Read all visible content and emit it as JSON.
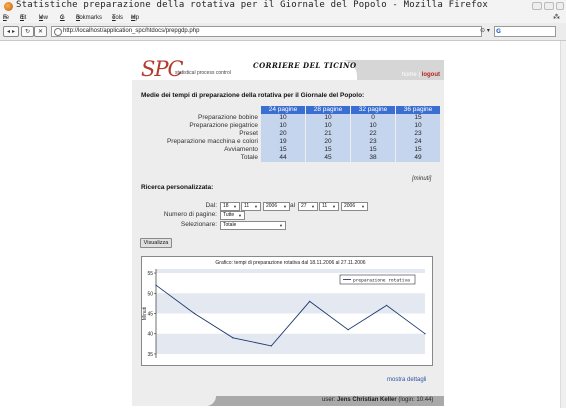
{
  "window": {
    "title": "Statistiche preparazione della rotativa per il Giornale del Popolo - Mozilla Firefox"
  },
  "menu": [
    {
      "label": "File",
      "key": "F"
    },
    {
      "label": "Edit",
      "key": "E"
    },
    {
      "label": "View",
      "key": "V"
    },
    {
      "label": "Go",
      "key": "G"
    },
    {
      "label": "Bookmarks",
      "key": "B"
    },
    {
      "label": "Tools",
      "key": "T"
    },
    {
      "label": "Help",
      "key": "H"
    }
  ],
  "nav": {
    "url": "http://localhost/application_spc/htdocs/prepgdp.php"
  },
  "header": {
    "logo": "SPC",
    "logo_sub": "statistical process control",
    "newspaper": "CORRIERE DEL TICINO",
    "home_link": "home",
    "separator": "|",
    "logout_link": "logout"
  },
  "times": {
    "title": "Medie dei tempi di preparazione della rotativa per il Giornale del Popolo:",
    "columns": [
      "24 pagine",
      "28 pagine",
      "32 pagine",
      "36 pagine"
    ],
    "rows": [
      {
        "label": "Preparazione bobine",
        "values": [
          "10",
          "10",
          "0",
          "15"
        ]
      },
      {
        "label": "Preparazione piegatrice",
        "values": [
          "10",
          "10",
          "10",
          "10"
        ]
      },
      {
        "label": "Preset",
        "values": [
          "20",
          "21",
          "22",
          "23"
        ]
      },
      {
        "label": "Preparazione macchina e colori",
        "values": [
          "19",
          "20",
          "23",
          "24"
        ]
      },
      {
        "label": "Avviamento",
        "values": [
          "15",
          "15",
          "15",
          "15"
        ]
      },
      {
        "label": "Totale",
        "values": [
          "44",
          "45",
          "38",
          "49"
        ]
      }
    ],
    "unit": "[minuti]"
  },
  "search": {
    "title": "Ricerca personalizzata:",
    "dal_label": "Dal:",
    "al_label": "al",
    "from_day": "18",
    "from_month": "11",
    "from_year": "2006",
    "to_day": "27",
    "to_month": "11",
    "to_year": "2006",
    "pages_label": "Numero di pagine:",
    "pages_value": "Tutte",
    "select_label": "Selezionare:",
    "select_value": "Totale",
    "submit": "Visualizza"
  },
  "chart_data": {
    "type": "line",
    "title": "Grafico: tempi di preparazione rotativa dal 18.11.2006 al 27.11.2006",
    "ylabel": "Minuti",
    "xlabel": "",
    "ylim": [
      34,
      56
    ],
    "yticks": [
      "35",
      "40",
      "45",
      "50",
      "55"
    ],
    "legend_position": "top-right",
    "series": [
      {
        "name": "preparazione rotativa",
        "values": [
          52,
          45,
          39,
          37,
          48,
          41,
          47,
          40
        ]
      }
    ]
  },
  "footer": {
    "details_link": "mostra dettagli",
    "user_prefix": "user:",
    "user_name": "Jens Christian Keller",
    "login_info": "(login: 10:44)"
  }
}
